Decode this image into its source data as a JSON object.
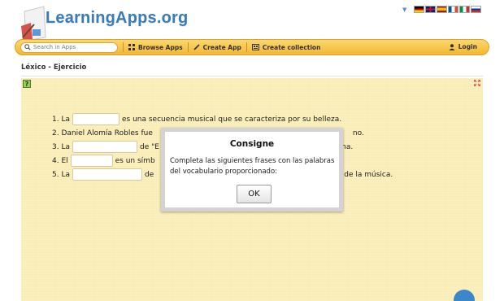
{
  "header": {
    "logo_text": "LearningApps.org",
    "languages": [
      {
        "name": "german-flag-icon",
        "colors": [
          "#000000",
          "#dd0000",
          "#ffce00"
        ]
      },
      {
        "name": "uk-flag-icon",
        "colors": [
          "#012169",
          "#ffffff",
          "#c8102e"
        ]
      },
      {
        "name": "spain-flag-icon",
        "colors": [
          "#aa151b",
          "#f1bf00",
          "#aa151b"
        ]
      },
      {
        "name": "france-flag-icon",
        "colors": [
          "#0055a4",
          "#ffffff",
          "#ef4135"
        ]
      },
      {
        "name": "italy-flag-icon",
        "colors": [
          "#009246",
          "#ffffff",
          "#ce2b37"
        ]
      },
      {
        "name": "russia-flag-icon",
        "colors": [
          "#ffffff",
          "#0039a6",
          "#d52b1e"
        ]
      }
    ]
  },
  "nav": {
    "search_placeholder": "Search in Apps",
    "browse_label": "Browse Apps",
    "create_label": "Create App",
    "collection_label": "Create collection",
    "login_label": "Login"
  },
  "page": {
    "title": "Léxico - Ejercicio"
  },
  "exercise": {
    "lines": [
      {
        "before": "1. La",
        "after": "es una secuencia musical que se caracteriza por su belleza."
      },
      {
        "before": "2. Daniel Alomía Robles fue",
        "after": "no."
      },
      {
        "before": "3. La",
        "mid": "de \"E",
        "after": "dina."
      },
      {
        "before": "4. El",
        "after": "es un símb"
      },
      {
        "before": "5. La",
        "mid": "de",
        "after": "de la música."
      }
    ]
  },
  "modal": {
    "title": "Consigne",
    "body": "Completa las siguientes frases con las palabras del vocabulario proporcionado:",
    "ok_label": "OK"
  }
}
